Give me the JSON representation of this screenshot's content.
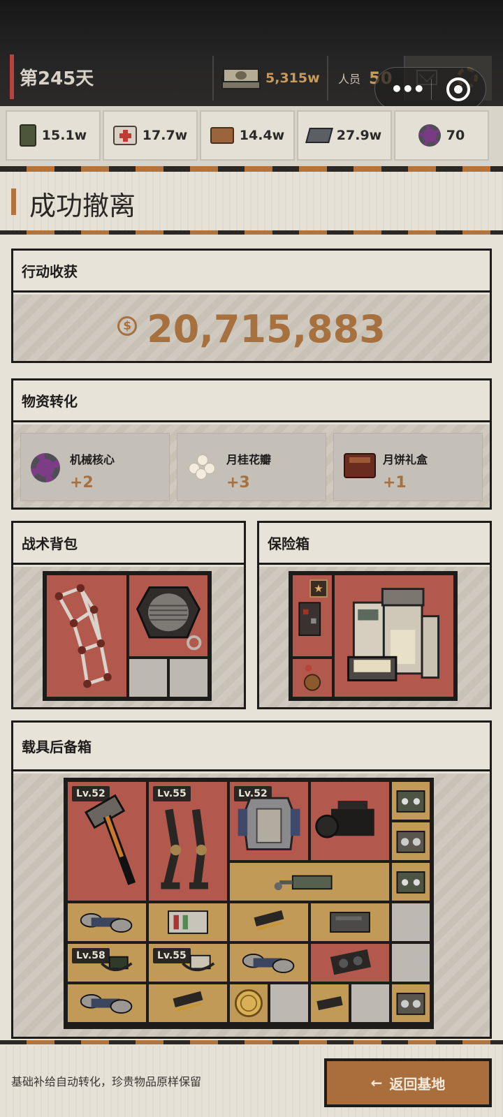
{
  "header": {
    "day": "第245天",
    "money": "5,315w",
    "crew_label": "人员",
    "crew_value": "50"
  },
  "resources": [
    {
      "icon": "wheat-crate-icon",
      "value": "15.1w"
    },
    {
      "icon": "medkit-icon",
      "value": "17.7w"
    },
    {
      "icon": "wood-planks-icon",
      "value": "14.4w"
    },
    {
      "icon": "steel-ingot-icon",
      "value": "27.9w"
    },
    {
      "icon": "mech-core-icon",
      "value": "70"
    }
  ],
  "title": "成功撤离",
  "income": {
    "label": "行动收获",
    "value": "20,715,883",
    "currency_symbol": "$"
  },
  "conversion": {
    "label": "物资转化",
    "items": [
      {
        "name": "机械核心",
        "amount": "+2",
        "icon": "mech-core-icon"
      },
      {
        "name": "月桂花瓣",
        "amount": "+3",
        "icon": "osmanthus-petal-icon"
      },
      {
        "name": "月饼礼盒",
        "amount": "+1",
        "icon": "mooncake-giftbox-icon"
      }
    ]
  },
  "backpack": {
    "label": "战术背包"
  },
  "safe": {
    "label": "保险箱"
  },
  "trunk": {
    "label": "载具后备箱",
    "levels": [
      "Lv.52",
      "Lv.55",
      "Lv.52",
      "Lv.58",
      "Lv.55"
    ]
  },
  "footer": {
    "note": "基础补给自动转化，珍贵物品原样保留",
    "back_button": "返回基地",
    "back_arrow": "←"
  },
  "colors": {
    "accent": "#a96e3c",
    "gold_text": "#c99a5e",
    "rare_slot": "#b3584c",
    "common_slot": "#c09a56",
    "empty_slot": "#bdb8b1"
  }
}
